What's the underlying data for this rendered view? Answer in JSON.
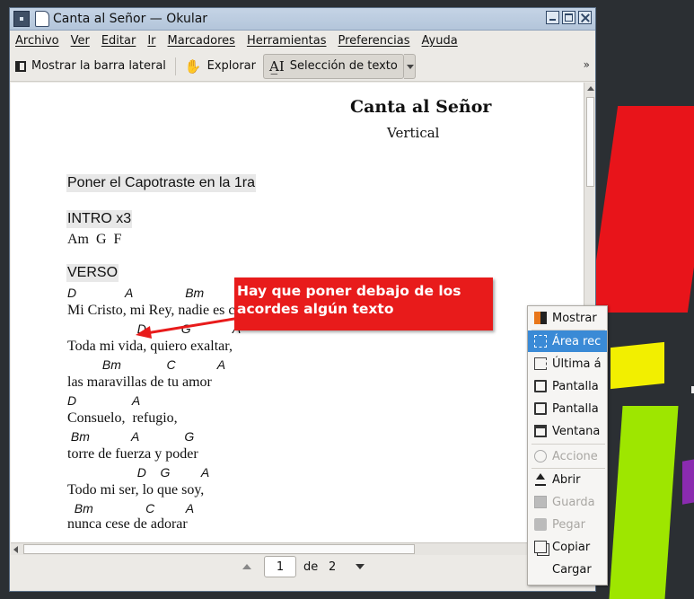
{
  "window": {
    "title": "Canta al Señor  — Okular"
  },
  "menu": [
    "Archivo",
    "Ver",
    "Editar",
    "Ir",
    "Marcadores",
    "Herramientas",
    "Preferencias",
    "Ayuda"
  ],
  "toolbar": {
    "sidebar_label": "Mostrar la barra lateral",
    "browse_label": "Explorar",
    "text_select_label": "Selección de texto",
    "overflow": "»"
  },
  "document": {
    "title": "Canta al Señor",
    "subtitle": "Vertical",
    "capo_note": "Poner el Capotraste en la 1ra",
    "intro_heading": "INTRO x3",
    "intro_chords": "Am  G  F",
    "verse_heading": "VERSO",
    "lines": [
      {
        "chords": "D              A               Bm         A       G",
        "lyrics": "Mi Cristo, mi Rey, nadie es como tu"
      },
      {
        "chords": "                    D          G            A",
        "lyrics": "Toda mi vida, quiero exaltar,"
      },
      {
        "chords": "          Bm             C            A",
        "lyrics": "las maravillas de tu amor"
      },
      {
        "chords": "D                A",
        "lyrics": "Consuelo,  refugio,"
      },
      {
        "chords": " Bm            A             G",
        "lyrics": "torre de fuerza y poder"
      },
      {
        "chords": "                    D    G         A",
        "lyrics": "Todo mi ser, lo que soy,"
      },
      {
        "chords": "  Bm               C         A",
        "lyrics": "nunca cese de adorar"
      }
    ]
  },
  "annotation": {
    "line1": "Hay que poner debajo de los",
    "line2": "acordes algún texto",
    "color": "#e81b1b"
  },
  "pagination": {
    "current": "1",
    "of_label": "de",
    "total": "2"
  },
  "context_menu": {
    "items": [
      {
        "label": "Mostrar",
        "icon": "app-icon",
        "state": "normal"
      },
      {
        "label": "Área rec",
        "icon": "rect-select-icon",
        "state": "highlighted"
      },
      {
        "label": "Última á",
        "icon": "last-area-icon",
        "state": "normal"
      },
      {
        "label": "Pantalla",
        "icon": "fullscreen-icon",
        "state": "normal"
      },
      {
        "label": "Pantalla",
        "icon": "screen-icon",
        "state": "normal"
      },
      {
        "label": "Ventana",
        "icon": "window-icon",
        "state": "normal"
      },
      {
        "label": "Accione",
        "icon": "actions-icon",
        "state": "disabled"
      },
      {
        "label": "Abrir",
        "icon": "open-icon",
        "state": "normal"
      },
      {
        "label": "Guarda",
        "icon": "save-icon",
        "state": "disabled"
      },
      {
        "label": "Pegar",
        "icon": "paste-icon",
        "state": "disabled"
      },
      {
        "label": "Copiar",
        "icon": "copy-icon",
        "state": "normal"
      },
      {
        "label": "Cargar",
        "icon": "",
        "state": "normal"
      }
    ]
  }
}
